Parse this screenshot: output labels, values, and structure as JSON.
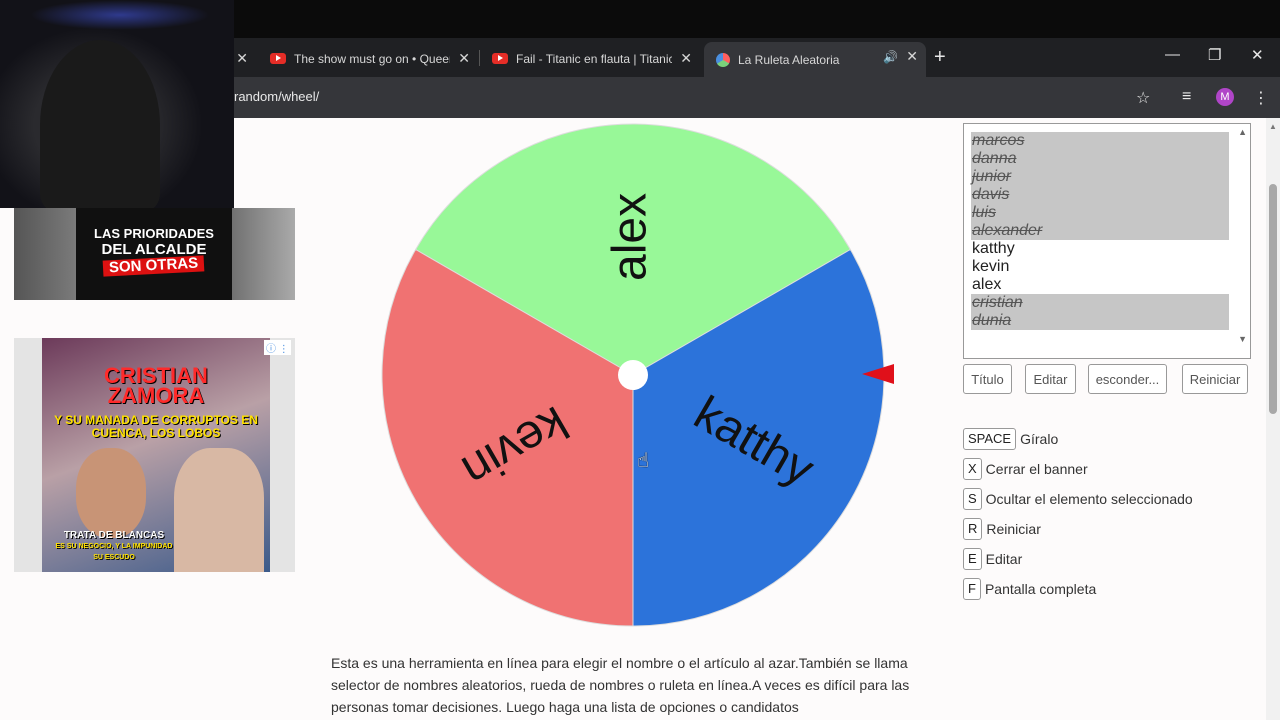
{
  "browser": {
    "tabs": [
      {
        "title": "The show must go on • Queen",
        "icon": "youtube-icon"
      },
      {
        "title": "Fail - Titanic en flauta | Titanic f",
        "icon": "youtube-icon"
      },
      {
        "title": "La Ruleta Aleatoria",
        "icon": "wheel-favicon",
        "active": true
      }
    ],
    "url": "random/wheel/",
    "profile_initial": "M"
  },
  "ads": {
    "ad1": {
      "line1": "LAS PRIORIDADES",
      "line2": "DEL ALCALDE",
      "line3": "SON OTRAS"
    },
    "ad2": {
      "headline1": "CRISTIAN",
      "headline2": "ZAMORA",
      "subline": "Y SU MANADA DE CORRUPTOS EN CUENCA, LOS LOBOS",
      "caption": "TRATA DE BLANCAS",
      "caption_small": "ES SU NEGOCIO, Y LA IMPUNIDAD SU ESCUDO"
    }
  },
  "wheel": {
    "segments": [
      {
        "label": "alex",
        "color": "#98f898"
      },
      {
        "label": "katthy",
        "color": "#2c73da"
      },
      {
        "label": "kevin",
        "color": "#f07272"
      }
    ],
    "pointer_color": "#e0101a"
  },
  "names": [
    {
      "label": "marcos",
      "hidden": true
    },
    {
      "label": "danna",
      "hidden": true
    },
    {
      "label": "junior",
      "hidden": true
    },
    {
      "label": "davis",
      "hidden": true
    },
    {
      "label": "luis",
      "hidden": true
    },
    {
      "label": "alexander",
      "hidden": true
    },
    {
      "label": "katthy",
      "hidden": false
    },
    {
      "label": "kevin",
      "hidden": false
    },
    {
      "label": "alex",
      "hidden": false
    },
    {
      "label": "cristian",
      "hidden": true
    },
    {
      "label": "dunia",
      "hidden": true
    }
  ],
  "buttons": {
    "title": "Título",
    "edit": "Editar",
    "hide": "esconder...",
    "reset": "Reiniciar"
  },
  "shortcuts": [
    {
      "key": "SPACE",
      "label": "Gíralo"
    },
    {
      "key": "X",
      "label": "Cerrar el banner"
    },
    {
      "key": "S",
      "label": "Ocultar el elemento seleccionado"
    },
    {
      "key": "R",
      "label": "Reiniciar"
    },
    {
      "key": "E",
      "label": "Editar"
    },
    {
      "key": "F",
      "label": "Pantalla completa"
    }
  ],
  "description": "Esta es una herramienta en línea para elegir el nombre o el artículo al azar.También se llama selector de nombres aleatorios, rueda de nombres o ruleta en línea.A veces es difícil para las personas tomar decisiones. Luego haga una lista de opciones o candidatos"
}
